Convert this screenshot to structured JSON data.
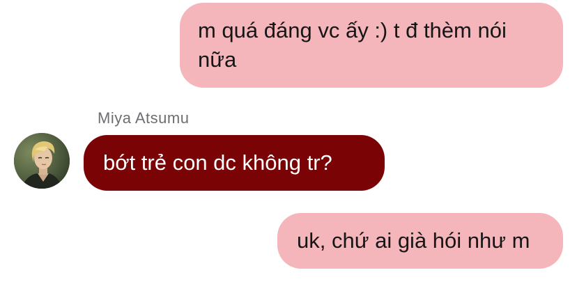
{
  "messages": [
    {
      "direction": "outgoing",
      "text": "m quá đáng vc ấy :) t đ thèm nói nữa"
    },
    {
      "direction": "incoming",
      "sender": "Miya Atsumu",
      "avatar_icon": "user-avatar",
      "text": "bớt trẻ con dc không tr?"
    },
    {
      "direction": "outgoing",
      "text": "uk, chứ ai già hói như m"
    }
  ],
  "colors": {
    "outgoing_bubble": "#f4b5bb",
    "incoming_bubble": "#7a0306",
    "outgoing_text": "#161616",
    "incoming_text": "#ffffff",
    "sender_name": "#6d6d72",
    "background": "#ffffff"
  }
}
